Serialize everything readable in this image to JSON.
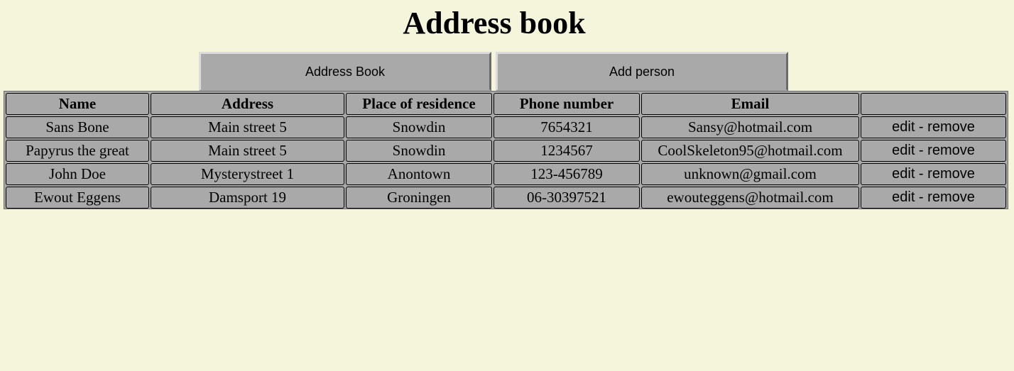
{
  "page": {
    "title": "Address book"
  },
  "nav": {
    "address_book": "Address Book",
    "add_person": "Add person"
  },
  "table": {
    "headers": [
      "Name",
      "Address",
      "Place of residence",
      "Phone number",
      "Email",
      ""
    ],
    "rows": [
      {
        "name": "Sans Bone",
        "address": "Main street 5",
        "place": "Snowdin",
        "phone": "7654321",
        "email": "Sansy@hotmail.com"
      },
      {
        "name": "Papyrus the great",
        "address": "Main street 5",
        "place": "Snowdin",
        "phone": "1234567",
        "email": "CoolSkeleton95@hotmail.com"
      },
      {
        "name": "John Doe",
        "address": "Mysterystreet 1",
        "place": "Anontown",
        "phone": "123-456789",
        "email": "unknown@gmail.com"
      },
      {
        "name": "Ewout Eggens",
        "address": "Damsport 19",
        "place": "Groningen",
        "phone": "06-30397521",
        "email": "ewouteggens@hotmail.com"
      }
    ],
    "edit_label": "edit",
    "separator": " - ",
    "remove_label": "remove"
  },
  "colors": {
    "background": "#f5f5dc",
    "button_bg": "#a9a9a9",
    "table_bg": "#a9a9a9"
  }
}
